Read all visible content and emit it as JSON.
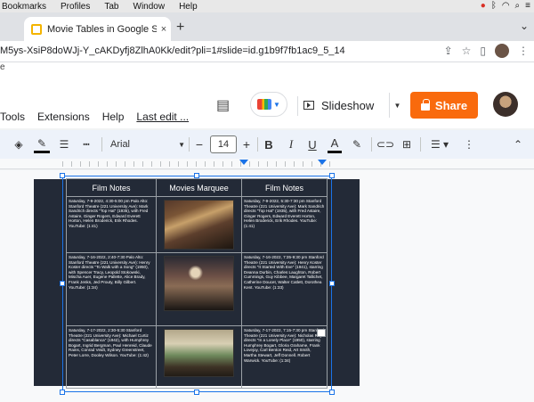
{
  "menubar": {
    "items": [
      "Bookmarks",
      "Profiles",
      "Tab",
      "Window",
      "Help"
    ]
  },
  "browser": {
    "tab_title": "Movie Tables in Google Slides",
    "tab_close": "×",
    "new_tab": "+",
    "url": "M5ys-XsiP8doWJj-Y_cAKDyfj8ZlhA0Kk/edit?pli=1#slide=id.g1b9f7fb1ac9_5_14"
  },
  "bookmarks_line": "e",
  "docs": {
    "menus": [
      "Tools",
      "Extensions",
      "Help"
    ],
    "last_edit": "Last edit ...",
    "slideshow_label": "Slideshow",
    "share_label": "Share"
  },
  "toolbar": {
    "font": "Arial",
    "size": "14",
    "minus": "−",
    "plus": "+"
  },
  "table": {
    "headers": [
      "Film Notes",
      "Movies Marquee",
      "Film Notes"
    ],
    "rows": [
      {
        "left": "Saturday, 7-9-2022, 4:30-5:00 pm Palo Alto: Stanford Theatre (221 University Ave): Mark Sandrich directs \"Top Hat\" (1935), with Fred Astaire, Ginger Rogers, Edward Everett Horton, Helen Broderick, Erik Rhodes. YouTube: (1:41)",
        "right": "Saturday, 7-9-2022, 5:30-7:30 pm Stanford Theatre (221 University Ave): Mark Sandrich directs \"Top Hat\" (1935), with Fred Astaire, Ginger Rogers, Edward Everett Horton, Helen Broderick, Erik Rhodes. YouTube: (1:41)"
      },
      {
        "left": "Saturday, 7-16-2022, 2:40-7:30 Palo Alto: Stanford Theatre (221 University Ave): Henry Koster directs \"To Walk with a Song\" (1950), with Spencer Tracy, Leopold Stokowski, Mischa Auer, Eugene Pallette, Alice Brady, Frank Jenks, Jed Prouty, Billy Gilbert. YouTube: (1:34)",
        "right": "Saturday, 7-16-2022, 7:35-9:30 pm Stanford Theatre (221 University Ave): Henry Koster directs \"It Started With Eve\" (1941), starring Deanna Durbin, Charles Laughton, Robert Cummings, Guy Kibbee, Margaret Tallichet, Catherine Doucet, Walter Catlett, Dorothea Kent. YouTube: (1:33)"
      },
      {
        "left": "Saturday, 7-17-2022, 2:30-5:30 Stanford Theatre (221 University Ave): Michael Curtiz directs \"Casablanca\" (1942), with Humphrey Bogart, Ingrid Bergman, Paul Henreid, Claude Rains, Conrad Veidt, Sydney Greenstreet, Peter Lorre, Dooley Wilson. YouTube: (1:42)",
        "right": "Saturday, 7-17-2022, 7:15-7:30 pm Stanford Theatre (221 University Ave): Nicholas Ray directs \"In a Lonely Place\" (1950), starring Humphrey Bogart, Gloria Grahame, Frank Lovejoy, Carl Benton Reid, Art Smith, Martha Stewart, Jeff Donnell. Robert Warwick. YouTube: (1:34)"
      }
    ]
  }
}
